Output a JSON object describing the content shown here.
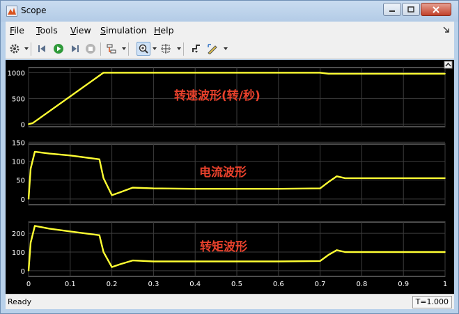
{
  "window": {
    "title": "Scope"
  },
  "menu": [
    {
      "mnemonic": "F",
      "rest": "ile"
    },
    {
      "mnemonic": "T",
      "rest": "ools"
    },
    {
      "mnemonic": "V",
      "rest": "iew"
    },
    {
      "mnemonic": "S",
      "rest": "imulation"
    },
    {
      "mnemonic": "H",
      "rest": "elp"
    }
  ],
  "toolbar_icons": [
    "gear-icon",
    "step-back-icon",
    "run-icon",
    "step-forward-icon",
    "stop-icon",
    "signal-config-icon",
    "zoom-icon",
    "fit-to-view-icon",
    "triggers-icon",
    "cursor-measurements-icon",
    "highlight-icon"
  ],
  "status": {
    "text": "Ready",
    "time": "T=1.000"
  },
  "colors": {
    "trace": "#ffff33",
    "annotation": "#e8412c",
    "axes_background": "#000000",
    "grid": "#3c3c3c",
    "tick_label": "#ffffff"
  },
  "chart_data": [
    {
      "type": "line",
      "annotation": "转速波形(转/秒)",
      "xlim": [
        0,
        1
      ],
      "ylim": [
        -50,
        1100
      ],
      "yticks": [
        0,
        500,
        1000
      ],
      "grid": true,
      "series": [
        {
          "x": [
            0,
            0.01,
            0.18,
            0.19,
            0.7,
            0.72,
            1.0
          ],
          "values": [
            0,
            20,
            1000,
            1000,
            1000,
            980,
            980
          ]
        }
      ]
    },
    {
      "type": "line",
      "annotation": "电流波形",
      "xlim": [
        0,
        1
      ],
      "ylim": [
        -15,
        145
      ],
      "yticks": [
        0,
        50,
        100,
        150
      ],
      "grid": true,
      "series": [
        {
          "x": [
            0,
            0.005,
            0.015,
            0.05,
            0.1,
            0.17,
            0.18,
            0.2,
            0.22,
            0.25,
            0.3,
            0.4,
            0.5,
            0.6,
            0.7,
            0.72,
            0.74,
            0.76,
            0.8,
            0.9,
            1.0
          ],
          "values": [
            0,
            80,
            125,
            120,
            115,
            105,
            55,
            10,
            18,
            30,
            28,
            27,
            27,
            27,
            28,
            45,
            60,
            55,
            55,
            55,
            55
          ]
        }
      ]
    },
    {
      "type": "line",
      "annotation": "转矩波形",
      "xlim": [
        0,
        1
      ],
      "ylim": [
        -30,
        260
      ],
      "yticks": [
        0,
        100,
        200
      ],
      "xticks": [
        0,
        0.1,
        0.2,
        0.3,
        0.4,
        0.5,
        0.6,
        0.7,
        0.8,
        0.9,
        1
      ],
      "grid": true,
      "series": [
        {
          "x": [
            0,
            0.005,
            0.015,
            0.05,
            0.1,
            0.17,
            0.18,
            0.2,
            0.22,
            0.25,
            0.3,
            0.4,
            0.5,
            0.6,
            0.7,
            0.72,
            0.74,
            0.76,
            0.8,
            0.9,
            1.0
          ],
          "values": [
            0,
            150,
            240,
            225,
            210,
            190,
            100,
            20,
            35,
            55,
            50,
            50,
            50,
            50,
            52,
            85,
            110,
            100,
            100,
            100,
            100
          ]
        }
      ]
    }
  ]
}
